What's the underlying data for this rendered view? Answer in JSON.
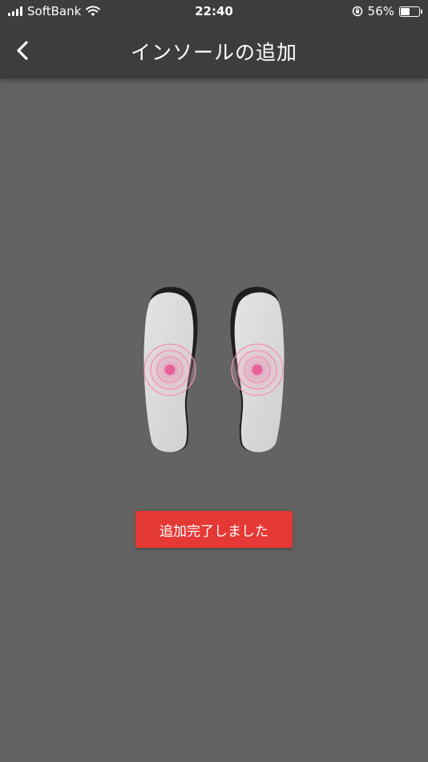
{
  "status_bar": {
    "carrier": "SoftBank",
    "time": "22:40",
    "battery_percent": "56%",
    "battery_level": 0.56,
    "icons": [
      "signal-icon",
      "wifi-icon",
      "rotation-lock-icon",
      "battery-icon"
    ]
  },
  "nav": {
    "back_icon": "chevron-left-icon",
    "title": "インソールの追加"
  },
  "insoles": {
    "left_name": "left-insole",
    "right_name": "right-insole",
    "pulse_color": "#e8609a"
  },
  "action": {
    "done_label": "追加完了しました",
    "color": "#e53935"
  }
}
